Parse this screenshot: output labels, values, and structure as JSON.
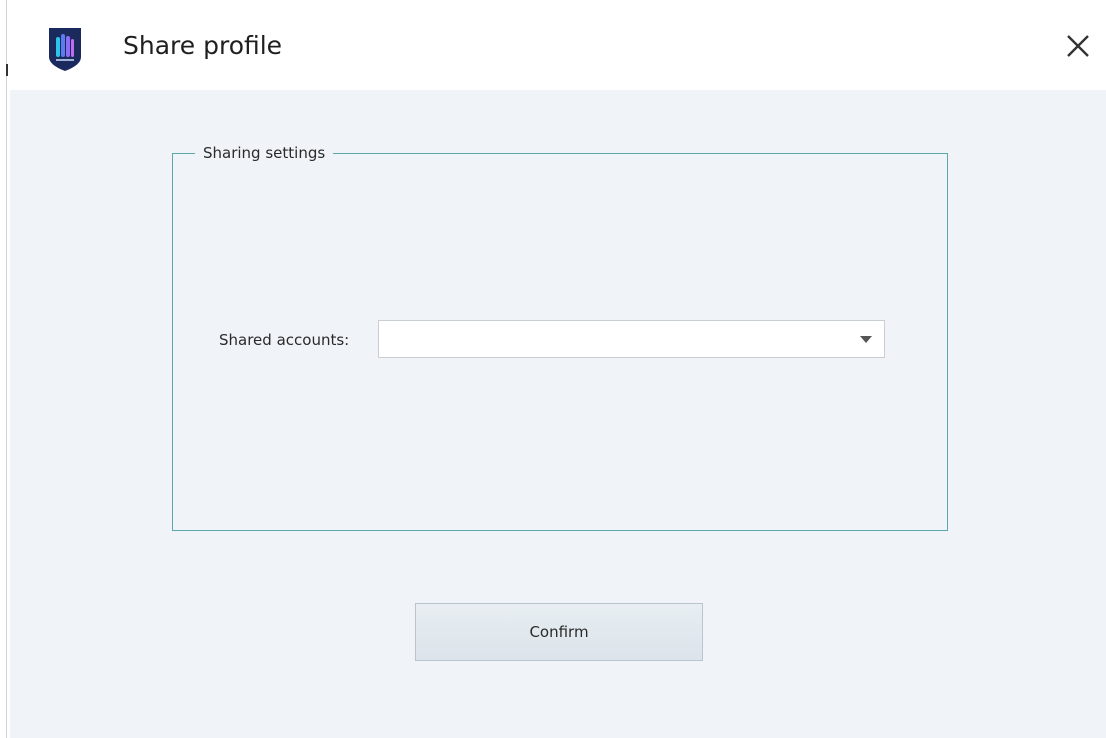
{
  "window": {
    "title": "Share profile",
    "logo_icon": "app-shield-logo-icon",
    "close_icon": "close-icon"
  },
  "sharing": {
    "legend": "Sharing settings",
    "shared_accounts_label": "Shared accounts:",
    "shared_accounts_value": "",
    "dropdown_icon": "chevron-down-icon"
  },
  "actions": {
    "confirm_label": "Confirm"
  },
  "colors": {
    "content_bg": "#f0f4f8",
    "groupbox_border": "#5ea8ac",
    "logo_shield": "#1a2a5c",
    "logo_accent": "#2ec4e8"
  }
}
